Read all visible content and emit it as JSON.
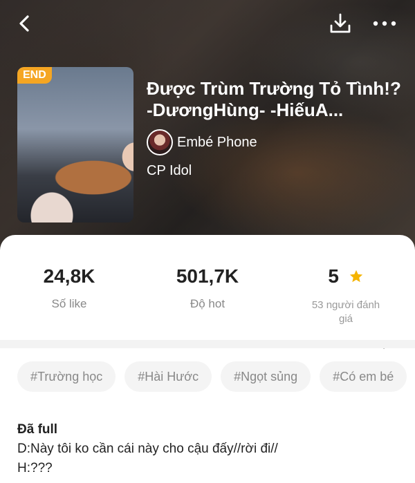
{
  "story": {
    "status_badge": "END",
    "title": "Được Trùm Trường Tỏ Tình!?-DươngHùng- -HiếuA...",
    "author": "Embé Phone",
    "category": "CP Idol"
  },
  "stats": {
    "likes_value": "24,8K",
    "likes_label": "Số like",
    "hot_value": "501,7K",
    "hot_label": "Độ hot",
    "rating_value": "5",
    "rating_label": "53 người đánh giá"
  },
  "tags": [
    "#Trường học",
    "#Hài Hước",
    "#Ngọt sủng",
    "#Có em bé"
  ],
  "description": {
    "title": "Đã full",
    "line1": "D:Này tôi ko cần cái này cho cậu đấy//rời đi//",
    "line2": "H:???"
  },
  "colors": {
    "accent": "#f5a623",
    "star": "#f5b400"
  },
  "icons": {
    "back": "back-arrow-icon",
    "download": "download-icon",
    "more": "more-dots-icon",
    "star": "star-icon",
    "chevron": "chevron-right-icon"
  }
}
